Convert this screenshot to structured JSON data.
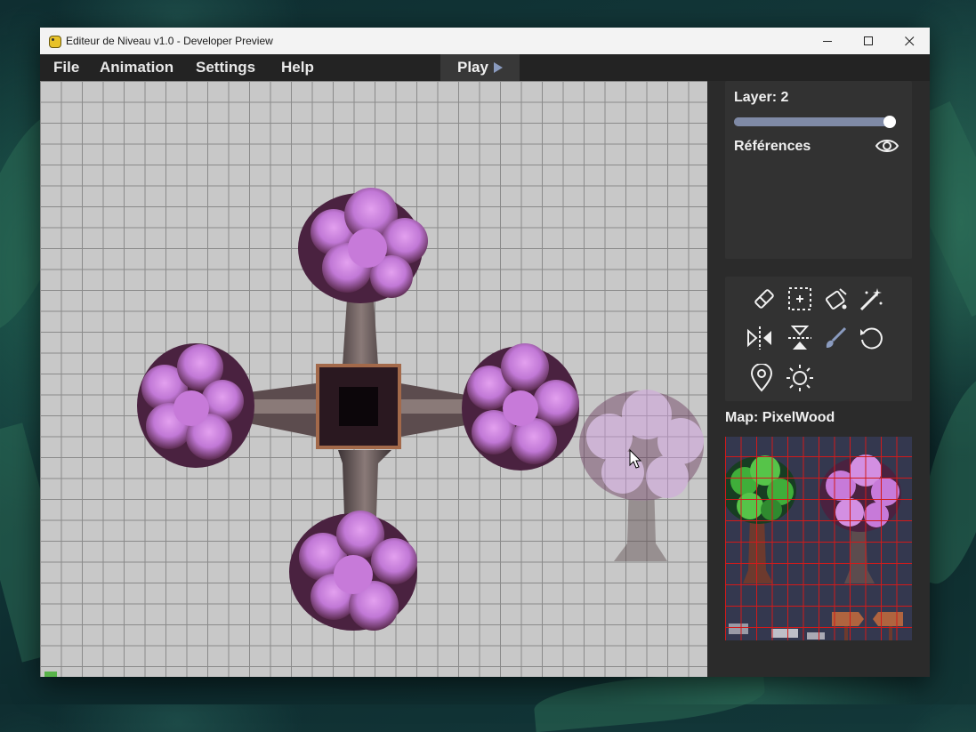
{
  "window": {
    "title": "Editeur de Niveau v1.0 - Developer Preview"
  },
  "menu": {
    "file": "File",
    "animation": "Animation",
    "settings": "Settings",
    "help": "Help",
    "play": "Play"
  },
  "layer_panel": {
    "layer_label": "Layer: 2",
    "layer_value": 2,
    "slider_fraction": 1.0,
    "references_label": "Références",
    "eye_icon": "eye-icon"
  },
  "tools": [
    {
      "name": "eraser-icon"
    },
    {
      "name": "select-icon"
    },
    {
      "name": "fill-bucket-icon"
    },
    {
      "name": "magic-wand-icon"
    },
    {
      "name": "flip-horizontal-icon"
    },
    {
      "name": "flip-vertical-icon"
    },
    {
      "name": "brush-icon",
      "active": true
    },
    {
      "name": "rotate-icon"
    },
    {
      "name": "pin-icon"
    },
    {
      "name": "sun-icon"
    }
  ],
  "map": {
    "label": "Map: PixelWood"
  },
  "colors": {
    "accent": "#7f8aa6",
    "canvas": "#c8c8c8",
    "panel": "#323232",
    "blossom": "#c77ad9",
    "map_bg": "#34384f",
    "map_grid": "#d21a1a"
  }
}
